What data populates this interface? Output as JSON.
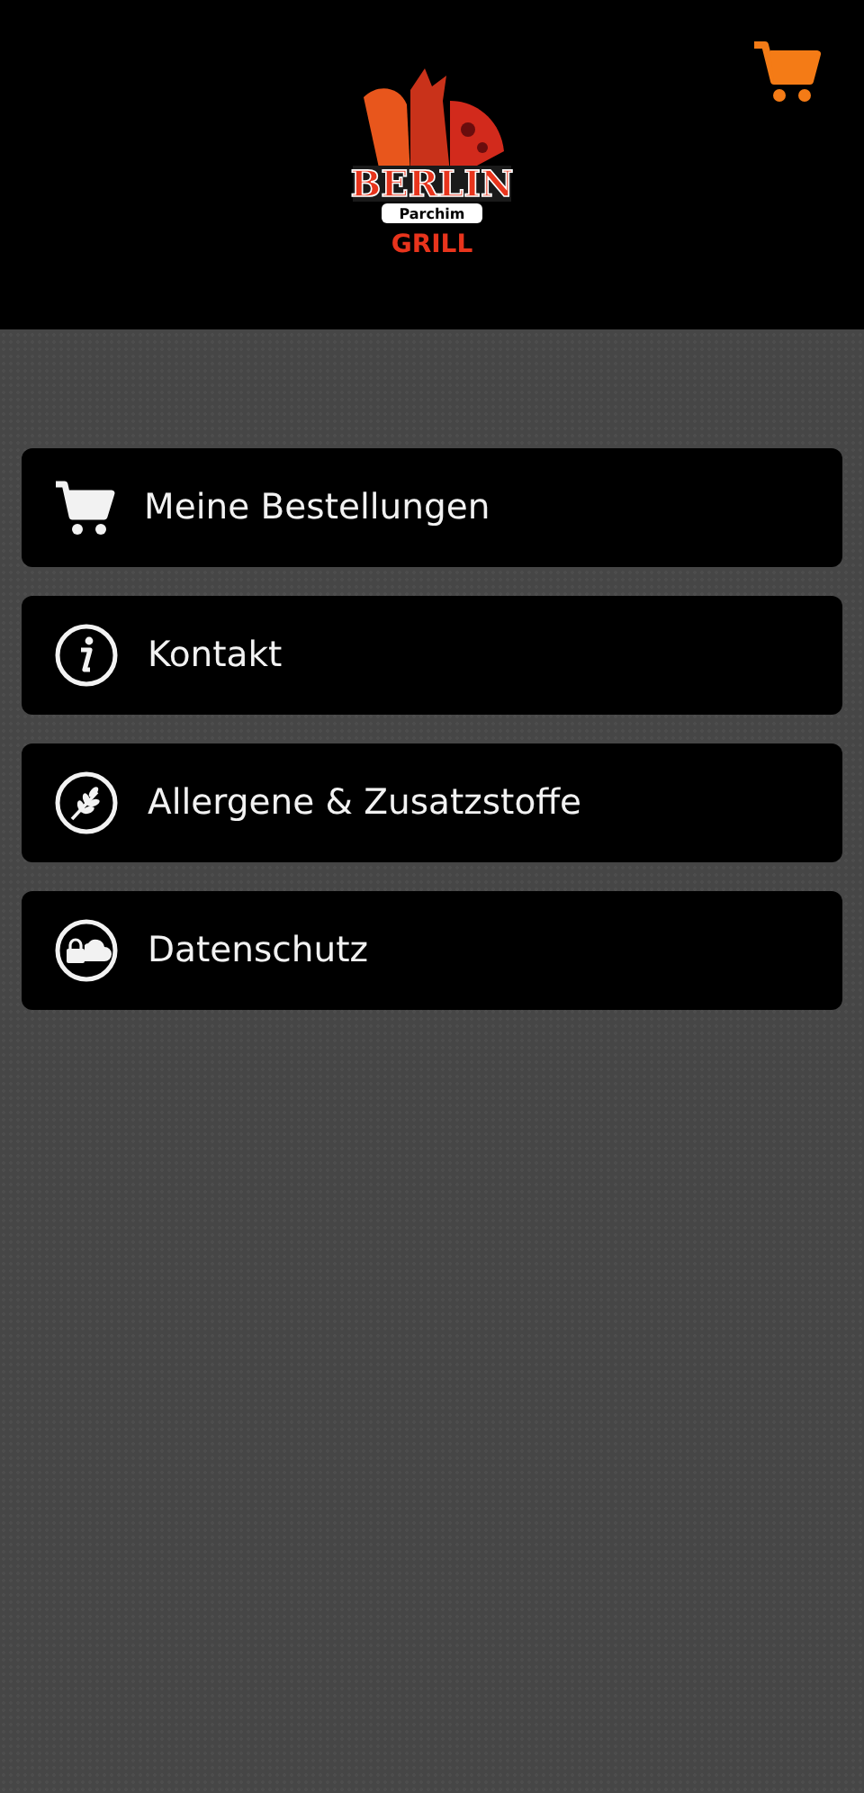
{
  "header": {
    "logo": {
      "title": "BERLIN",
      "subtitle": "Parchim",
      "tagline": "GRILL"
    }
  },
  "menu": [
    {
      "kind": "cart",
      "label": "Meine Bestellungen"
    },
    {
      "kind": "info",
      "label": "Kontakt"
    },
    {
      "kind": "allergen",
      "label": "Allergene & Zusatzstoffe"
    },
    {
      "kind": "privacy",
      "label": "Datenschutz"
    }
  ]
}
